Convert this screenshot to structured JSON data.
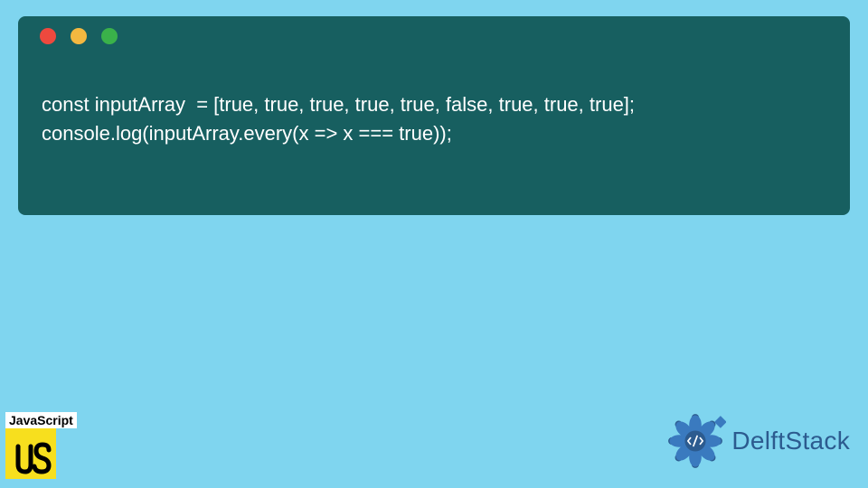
{
  "window": {
    "dots": {
      "red": "#ee493e",
      "yellow": "#f4b840",
      "green": "#3ab14a"
    }
  },
  "code": {
    "line1": "const inputArray  = [true, true, true, true, true, false, true, true, true];",
    "line2": "console.log(inputArray.every(x => x === true));"
  },
  "jsBadge": {
    "label": "JavaScript",
    "logoText": "JS"
  },
  "brand": {
    "name": "DelftStack"
  },
  "colors": {
    "pageBg": "#7fd5ef",
    "windowBg": "#175f60",
    "jsYellow": "#f7df1e",
    "brandBlue": "#2c5b8f"
  }
}
